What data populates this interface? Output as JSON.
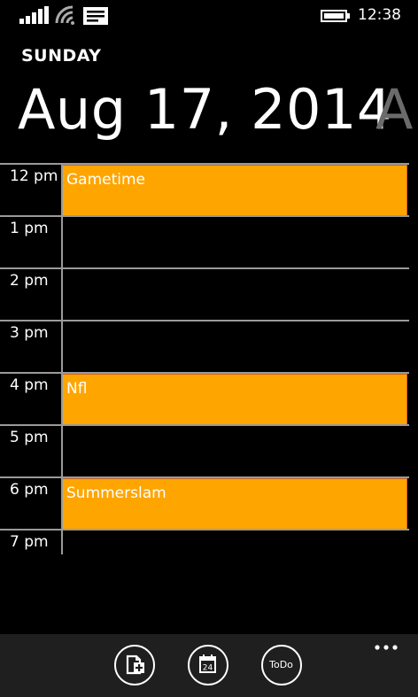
{
  "status_bar": {
    "time": "12:38",
    "icons": [
      "signal-icon",
      "wifi-icon",
      "message-icon",
      "battery-icon"
    ]
  },
  "header": {
    "weekday": "SUNDAY",
    "date": "Aug 17, 2014",
    "next_peek": "A"
  },
  "schedule": {
    "slots": [
      {
        "hour": "12 pm",
        "event": "Gametime"
      },
      {
        "hour": "1 pm",
        "event": ""
      },
      {
        "hour": "2 pm",
        "event": ""
      },
      {
        "hour": "3 pm",
        "event": ""
      },
      {
        "hour": "4 pm",
        "event": "Nfl"
      },
      {
        "hour": "5 pm",
        "event": ""
      },
      {
        "hour": "6 pm",
        "event": "Summerslam"
      },
      {
        "hour": "7 pm",
        "event": ""
      }
    ]
  },
  "app_bar": {
    "buttons": [
      {
        "icon": "add-event-icon"
      },
      {
        "icon": "calendar-icon",
        "day": "24"
      },
      {
        "icon": "todo-icon",
        "label": "ToDo"
      }
    ],
    "more_icon": "more-dots-icon"
  },
  "colors": {
    "background": "#000000",
    "event": "#ffa500",
    "event_border": "#c8631f",
    "gridline": "#9a9a9a",
    "app_bar": "#1f1f1f",
    "date_peek": "#6b6b6b"
  }
}
